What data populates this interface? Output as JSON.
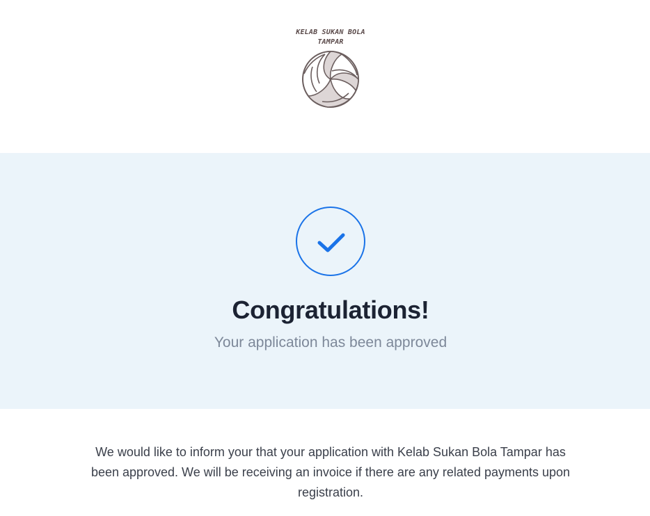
{
  "logo": {
    "line1": "KELAB SUKAN BOLA",
    "line2": "TAMPAR",
    "icon": "volleyball-icon"
  },
  "hero": {
    "icon": "checkmark-icon",
    "title": "Congratulations!",
    "subtitle": "Your application has been approved"
  },
  "message": {
    "text": "We would like to inform your that your application with Kelab Sukan Bola Tampar has been approved. We will be receiving an invoice if there are any related payments upon registration."
  },
  "colors": {
    "hero_background": "#ebf4fa",
    "accent": "#1a73e8",
    "title": "#1c2333",
    "subtitle": "#7d8899"
  }
}
